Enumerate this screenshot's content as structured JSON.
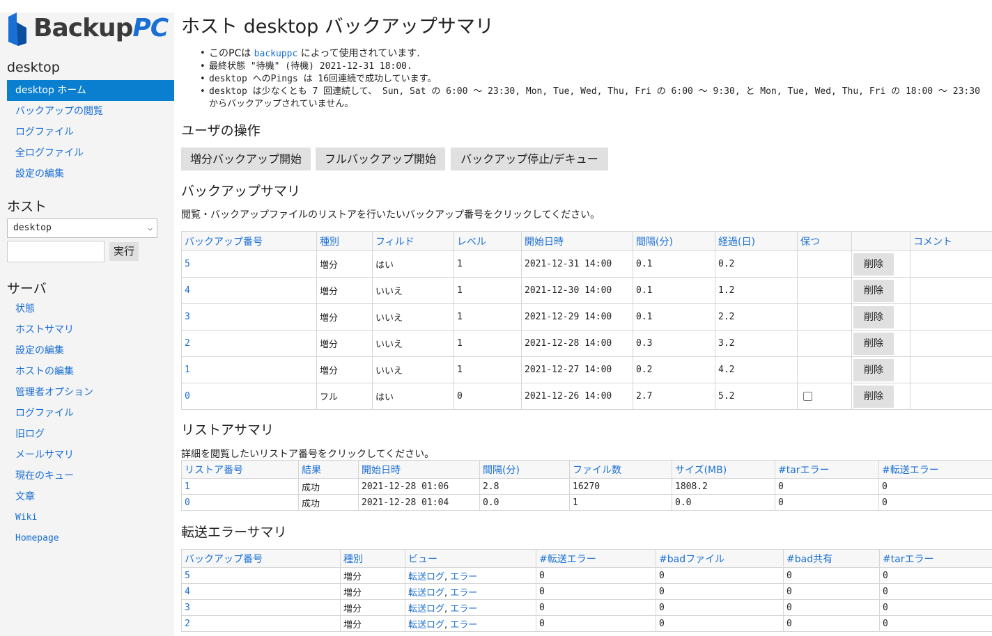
{
  "logo": {
    "text_main": "Backup",
    "text_accent": "PC"
  },
  "sidebar": {
    "host_heading": "desktop",
    "host_items": [
      {
        "label": "desktop ホーム"
      },
      {
        "label": "バックアップの閲覧"
      },
      {
        "label": "ログファイル"
      },
      {
        "label": "全ログファイル"
      },
      {
        "label": "設定の編集"
      }
    ],
    "hosts_heading": "ホスト",
    "host_select_value": "desktop",
    "run_button": "実行",
    "server_heading": "サーバ",
    "server_items": [
      {
        "label": "状態"
      },
      {
        "label": "ホストサマリ"
      },
      {
        "label": "設定の編集"
      },
      {
        "label": "ホストの編集"
      },
      {
        "label": "管理者オプション"
      },
      {
        "label": "ログファイル"
      },
      {
        "label": "旧ログ"
      },
      {
        "label": "メールサマリ"
      },
      {
        "label": "現在のキュー"
      },
      {
        "label": "文章"
      },
      {
        "label": "Wiki"
      },
      {
        "label": "Homepage"
      }
    ]
  },
  "main": {
    "title": "ホスト desktop バックアップサマリ",
    "summary": {
      "line1_pre": "このPCは ",
      "line1_link": "backuppc",
      "line1_post": " によって使用されています.",
      "line2": "最終状態 \"待機\" (待機) 2021-12-31 18:00.",
      "line3": "desktop へのPings は 16回連続で成功しています。",
      "line4": "desktop は少なくとも 7 回連続して、 Sun, Sat の 6:00 〜 23:30, Mon, Tue, Wed, Thu, Fri の 6:00 〜 9:30, と Mon, Tue, Wed, Thu, Fri の 18:00 〜 23:30 からバックアップされていません。"
    },
    "user_actions_heading": "ユーザの操作",
    "actions": {
      "incr": "増分バックアップ開始",
      "full": "フルバックアップ開始",
      "stop": "バックアップ停止/デキュー"
    },
    "backup_summary_heading": "バックアップサマリ",
    "backup_note": "閲覧・バックアップファイルのリストアを行いたいバックアップ番号をクリックしてください。",
    "backup_table": {
      "headers": [
        "バックアップ番号",
        "種別",
        "フィルド",
        "レベル",
        "開始日時",
        "間隔(分)",
        "経過(日)",
        "保つ",
        "",
        "コメント"
      ],
      "delete_label": "削除",
      "rows": [
        {
          "num": "5",
          "type": "増分",
          "filled": "はい",
          "level": "1",
          "start": "2021-12-31 14:00",
          "dur": "0.1",
          "age": "0.2",
          "keep": false
        },
        {
          "num": "4",
          "type": "増分",
          "filled": "いいえ",
          "level": "1",
          "start": "2021-12-30 14:00",
          "dur": "0.1",
          "age": "1.2",
          "keep": false
        },
        {
          "num": "3",
          "type": "増分",
          "filled": "いいえ",
          "level": "1",
          "start": "2021-12-29 14:00",
          "dur": "0.1",
          "age": "2.2",
          "keep": false
        },
        {
          "num": "2",
          "type": "増分",
          "filled": "いいえ",
          "level": "1",
          "start": "2021-12-28 14:00",
          "dur": "0.3",
          "age": "3.2",
          "keep": false
        },
        {
          "num": "1",
          "type": "増分",
          "filled": "いいえ",
          "level": "1",
          "start": "2021-12-27 14:00",
          "dur": "0.2",
          "age": "4.2",
          "keep": false
        },
        {
          "num": "0",
          "type": "フル",
          "filled": "はい",
          "level": "0",
          "start": "2021-12-26 14:00",
          "dur": "2.7",
          "age": "5.2",
          "keep": true
        }
      ]
    },
    "restore_heading": "リストアサマリ",
    "restore_note": "詳細を閲覧したいリストア番号をクリックしてください。",
    "restore_table": {
      "headers": [
        "リストア番号",
        "結果",
        "開始日時",
        "間隔(分)",
        "ファイル数",
        "サイズ(MB)",
        "#tarエラー",
        "#転送エラー"
      ],
      "rows": [
        {
          "num": "1",
          "result": "成功",
          "start": "2021-12-28 01:06",
          "dur": "2.8",
          "files": "16270",
          "size": "1808.2",
          "tar": "0",
          "xfer": "0"
        },
        {
          "num": "0",
          "result": "成功",
          "start": "2021-12-28 01:04",
          "dur": "0.0",
          "files": "1",
          "size": "0.0",
          "tar": "0",
          "xfer": "0"
        }
      ]
    },
    "xfer_heading": "転送エラーサマリ",
    "xfer_table": {
      "headers": [
        "バックアップ番号",
        "種別",
        "ビュー",
        "#転送エラー",
        "#badファイル",
        "#bad共有",
        "#tarエラー"
      ],
      "log_label": "転送ログ",
      "sep": ", ",
      "err_label": "エラー",
      "rows": [
        {
          "num": "5",
          "type": "増分",
          "xfer": "0",
          "badfile": "0",
          "badshare": "0",
          "tar": "0"
        },
        {
          "num": "4",
          "type": "増分",
          "xfer": "0",
          "badfile": "0",
          "badshare": "0",
          "tar": "0"
        },
        {
          "num": "3",
          "type": "増分",
          "xfer": "0",
          "badfile": "0",
          "badshare": "0",
          "tar": "0"
        },
        {
          "num": "2",
          "type": "増分",
          "xfer": "0",
          "badfile": "0",
          "badshare": "0",
          "tar": "0"
        }
      ]
    }
  }
}
